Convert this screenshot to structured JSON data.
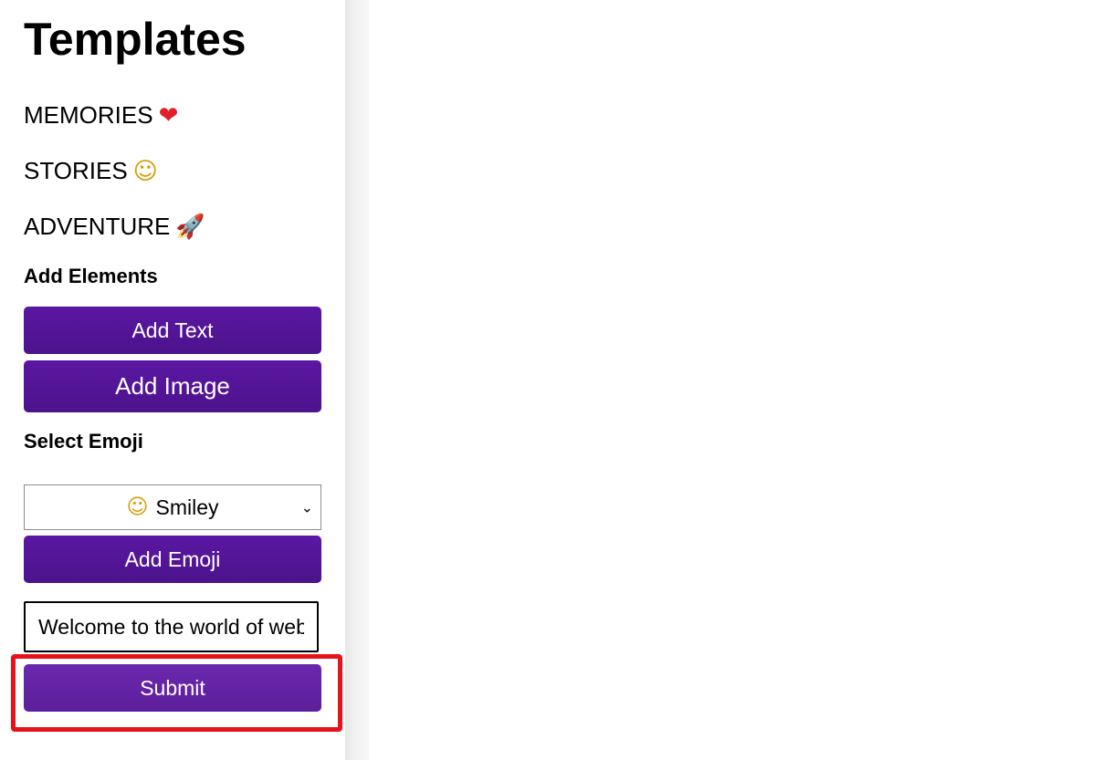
{
  "sidebar": {
    "title": "Templates",
    "templates": [
      {
        "label": "MEMORIES",
        "emoji": "❤"
      },
      {
        "label": "STORIES",
        "emoji": "☺"
      },
      {
        "label": "ADVENTURE",
        "emoji": "🚀"
      }
    ],
    "add_elements_heading": "Add Elements",
    "add_text_label": "Add Text",
    "add_image_label": "Add Image",
    "select_emoji_heading": "Select Emoji",
    "emoji_select": {
      "selected_emoji": "☺",
      "selected_label": "Smiley",
      "chevron": "⌄"
    },
    "add_emoji_label": "Add Emoji",
    "text_input_value": "Welcome to the world of web",
    "submit_label": "Submit"
  },
  "colors": {
    "button_purple": "#5b17a3",
    "highlight_red": "#e8121a"
  },
  "icons": {
    "memories": "heart-icon",
    "stories": "smiley-icon",
    "adventure": "rocket-icon"
  }
}
